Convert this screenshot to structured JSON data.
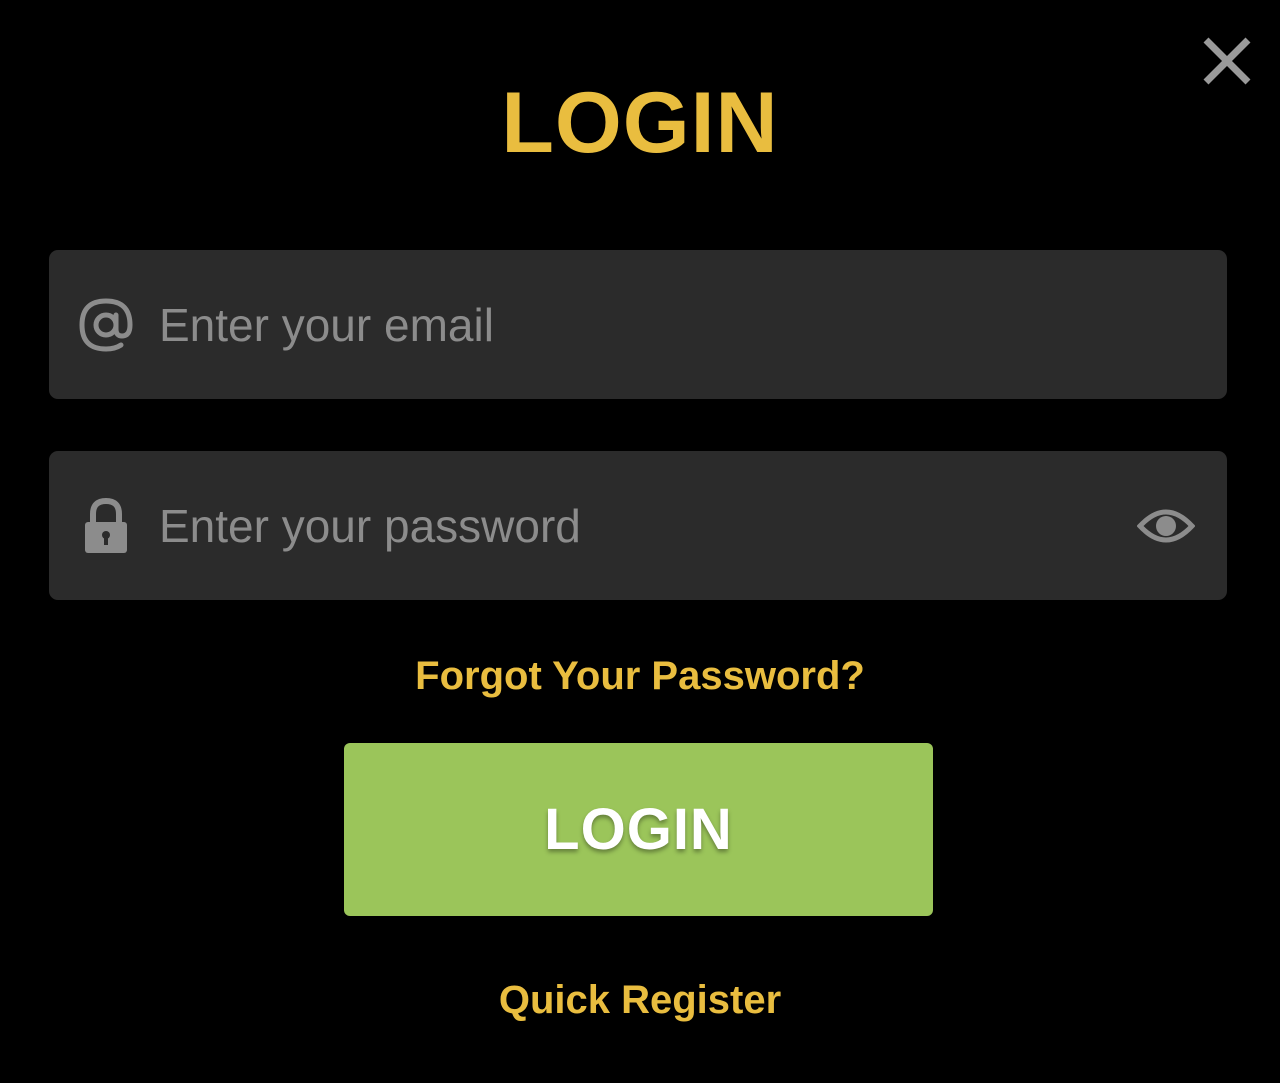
{
  "colors": {
    "background": "#000000",
    "accent": "#e9bd3f",
    "field_background": "#2b2b2b",
    "icon": "#8c8c8c",
    "close_icon": "#9a9a9a",
    "button_background": "#9bc55a",
    "button_text": "#ffffff"
  },
  "modal": {
    "title": "LOGIN",
    "close_icon": "close-icon"
  },
  "form": {
    "email": {
      "icon": "at-sign-icon",
      "placeholder": "Enter your email",
      "value": ""
    },
    "password": {
      "icon": "lock-icon",
      "placeholder": "Enter your password",
      "value": "",
      "toggle_icon": "eye-icon"
    },
    "forgot_label": "Forgot Your Password?",
    "submit_label": "LOGIN",
    "register_label": "Quick Register"
  }
}
